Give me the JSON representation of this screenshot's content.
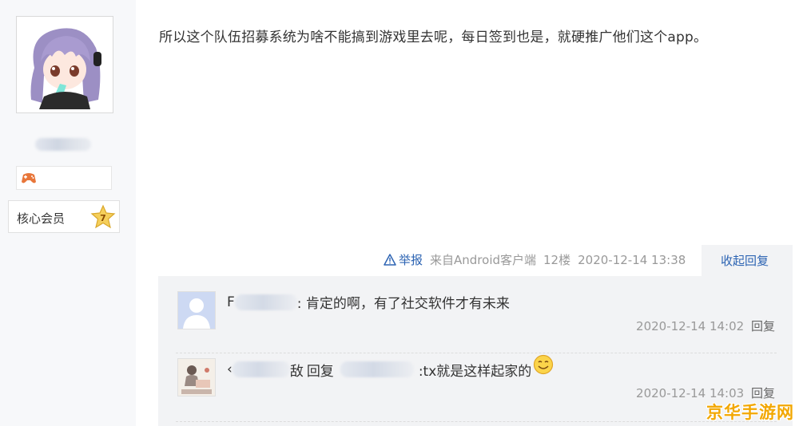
{
  "post": {
    "text": "所以这个队伍招募系统为啥不能搞到游戏里去呢，每日签到也是，就硬推广他们这个app。",
    "report_label": "举报",
    "source": "来自Android客户端",
    "floor": "12楼",
    "time": "2020-12-14 13:38",
    "fold_label": "收起回复"
  },
  "author": {
    "level_label": "核心会员",
    "level": "7"
  },
  "replies": [
    {
      "prefix": "F",
      "text": ": 肯定的啊，有了社交软件才有未来",
      "time": "2020-12-14 14:02",
      "reply_label": "回复"
    },
    {
      "prefix": "‹",
      "name_tail": "敌",
      "reply_word": "回复",
      "text": ":tx就是这样起家的",
      "time": "2020-12-14 14:03",
      "reply_label": "回复"
    }
  ],
  "watermark": "京华手游网",
  "colors": {
    "link": "#2d64b3",
    "meta": "#999999",
    "reply_bg": "#f2f3f5",
    "watermark": "#f2a700"
  }
}
